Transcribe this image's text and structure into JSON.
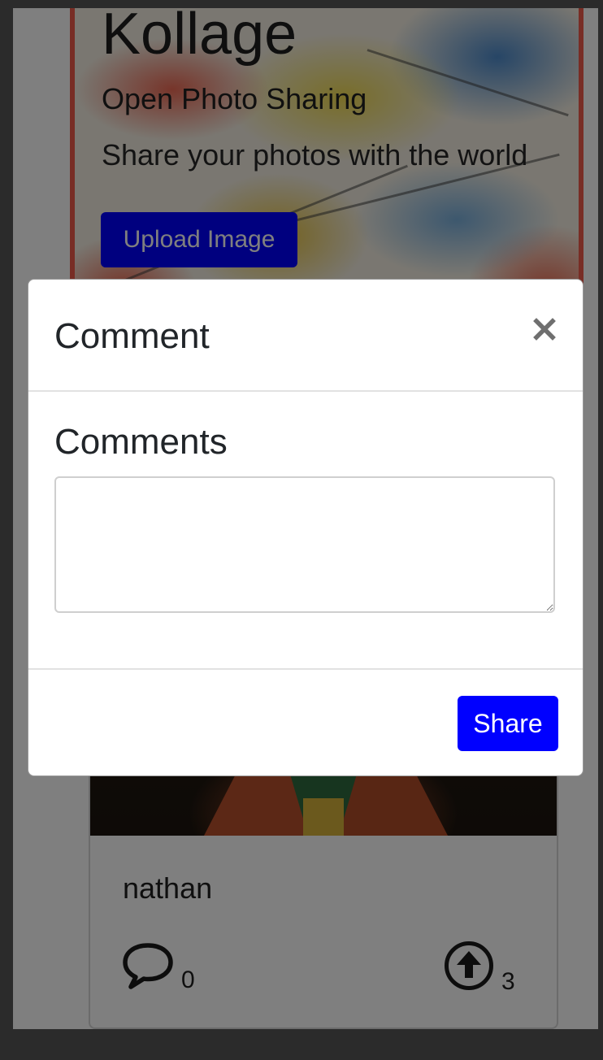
{
  "hero": {
    "title": "Kollage",
    "subtitle": "Open Photo Sharing",
    "lead": "Share your photos with the world",
    "upload_label": "Upload Image"
  },
  "post": {
    "username": "nathan",
    "comment_count": "0",
    "upvote_count": "3",
    "comment_icon": "speech-bubble-icon",
    "upvote_icon": "arrow-up-circle-icon"
  },
  "modal": {
    "title": "Comment",
    "close_icon": "close-icon",
    "field_label": "Comments",
    "textarea_value": "",
    "share_label": "Share"
  },
  "colors": {
    "primary": "#0000ff",
    "backdrop": "rgba(0,0,0,0.5)"
  }
}
